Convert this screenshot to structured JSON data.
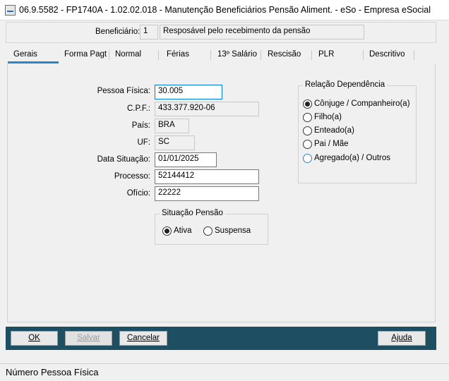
{
  "window": {
    "title": "06.9.5582 - FP1740A - 1.02.02.018 - Manutenção Beneficiários Pensão Aliment. - eSo - Empresa eSocial"
  },
  "header": {
    "beneficiario_label": "Beneficiário:",
    "beneficiario_num": "1",
    "beneficiario_desc": "Resposável pelo recebimento da pensão"
  },
  "tabs": [
    {
      "label": "Gerais",
      "active": true
    },
    {
      "label": "Forma Pagt"
    },
    {
      "label": "Normal"
    },
    {
      "label": "Férias"
    },
    {
      "label": "13º Salário"
    },
    {
      "label": "Rescisão"
    },
    {
      "label": "PLR"
    },
    {
      "label": "Descritivo"
    }
  ],
  "form": {
    "pessoa_fisica_label": "Pessoa Física:",
    "pessoa_fisica": "30.005",
    "cpf_label": "C.P.F.:",
    "cpf": "433.377.920-06",
    "pais_label": "País:",
    "pais": "BRA",
    "uf_label": "UF:",
    "uf": "SC",
    "data_situacao_label": "Data Situação:",
    "data_situacao": "01/01/2025",
    "processo_label": "Processo:",
    "processo": "52144412",
    "oficio_label": "Ofício:",
    "oficio": "22222"
  },
  "relacao": {
    "title": "Relação Dependência",
    "options": [
      {
        "label": "Cônjuge / Companheiro(a)",
        "checked": true
      },
      {
        "label": "Filho(a)"
      },
      {
        "label": "Enteado(a)"
      },
      {
        "label": "Pai / Mãe"
      },
      {
        "label": "Agregado(a) / Outros"
      }
    ]
  },
  "situacao": {
    "title": "Situação Pensão",
    "options": [
      {
        "label": "Ativa",
        "checked": true
      },
      {
        "label": "Suspensa"
      }
    ]
  },
  "buttons": {
    "ok": "OK",
    "salvar": "Salvar",
    "cancelar": "Cancelar",
    "ajuda": "Ajuda"
  },
  "status": {
    "text": "Número Pessoa Física"
  },
  "colors": {
    "button_bar": "#1d4e62",
    "tab_accent": "#2b86c9",
    "focus_border": "#0078d7"
  }
}
